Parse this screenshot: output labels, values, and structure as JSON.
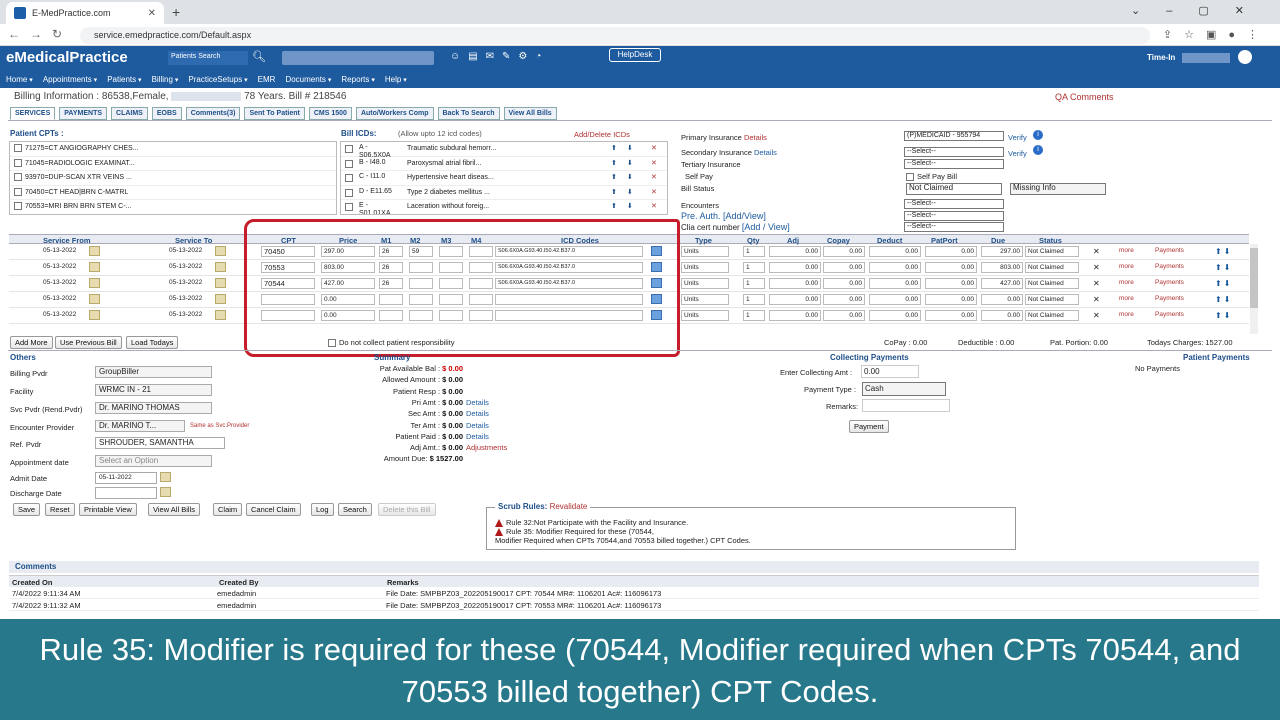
{
  "browser": {
    "tab_title": "E-MedPractice.com",
    "url": "service.emedpractice.com/Default.aspx"
  },
  "header": {
    "logo": "eMedicalPractice",
    "patient_search_placeholder": "Patients Search",
    "helpdesk": "HelpDesk",
    "time_in": "Time-In"
  },
  "menu": [
    "Home",
    "Appointments",
    "Patients",
    "Billing",
    "PracticeSetups",
    "EMR",
    "Documents",
    "Reports",
    "Help"
  ],
  "billing_info": {
    "prefix": "Billing Information :",
    "patient": "86538,Female,",
    "age": "78 Years.",
    "bill_no": "Bill # 218546",
    "qa": "QA Comments"
  },
  "bill_tabs": [
    "SERVICES",
    "PAYMENTS",
    "CLAIMS",
    "EOBS",
    "Comments(3)",
    "Sent To Patient",
    "CMS 1500",
    "Auto/Workers Comp",
    "Back To Search",
    "View All Bills"
  ],
  "patient_cpts": {
    "label": "Patient CPTs :",
    "items": [
      "71275=CT ANGIOGRAPHY CHES...",
      "71045=RADIOLOGIC EXAMINAT...",
      "93970=DUP-SCAN XTR VEINS ...",
      "70450=CT HEAD|BRN C-MATRL",
      "70553=MRI BRN BRN STEM C-..."
    ]
  },
  "bill_icds": {
    "label": "Bill ICDs:",
    "hint": "(Allow upto 12 icd codes)",
    "add_delete": "Add/Delete ICDs",
    "items": [
      {
        "code": "A - S06.5X0A",
        "desc": "Traumatic subdural hemorr..."
      },
      {
        "code": "B - I48.0",
        "desc": "Paroxysmal atrial fibril..."
      },
      {
        "code": "C - I11.0",
        "desc": "Hypertensive heart diseas..."
      },
      {
        "code": "D - E11.65",
        "desc": "Type 2 diabetes mellitus ..."
      },
      {
        "code": "E - S01.01XA",
        "desc": "Laceration without foreig..."
      }
    ]
  },
  "insurance": {
    "primary": "Primary Insurance",
    "secondary": "Secondary Insurance",
    "tertiary": "Tertiary Insurance",
    "self_pay": "Self Pay",
    "details": "Details",
    "verify": "Verify",
    "primary_value": "(P)MEDICAID - 955794",
    "select": "--Select--",
    "self_pay_bill": "Self Pay Bill",
    "bill_status": "Bill Status",
    "bill_status_value": "Not Claimed",
    "missing_info": "Missing Info",
    "encounters": "Encounters",
    "pre_auth": "Pre. Auth.",
    "clia": "Clia cert number",
    "add_view": "[Add/View]",
    "add_view2": "[Add / View]"
  },
  "services_header": [
    "Service From",
    "Service To",
    "CPT",
    "Price",
    "M1",
    "M2",
    "M3",
    "M4",
    "ICD Codes",
    "Type",
    "Qty",
    "Adj",
    "Copay",
    "Deduct",
    "PatPort",
    "Due",
    "Status"
  ],
  "services": [
    {
      "from": "05-13-2022",
      "to": "05-13-2022",
      "cpt": "70450",
      "price": "297.00",
      "m1": "26",
      "m2": "59",
      "icd": "S06.6X0A.G93.40.I50.42.B37.0",
      "type": "Units",
      "qty": "1",
      "adj": "0.00",
      "copay": "0.00",
      "deduct": "0.00",
      "patport": "0.00",
      "due": "297.00",
      "status": "Not Claimed"
    },
    {
      "from": "05-13-2022",
      "to": "05-13-2022",
      "cpt": "70553",
      "price": "803.00",
      "m1": "26",
      "m2": "",
      "icd": "S06.6X0A.G93.40.I50.42.B37.0",
      "type": "Units",
      "qty": "1",
      "adj": "0.00",
      "copay": "0.00",
      "deduct": "0.00",
      "patport": "0.00",
      "due": "803.00",
      "status": "Not Claimed"
    },
    {
      "from": "05-13-2022",
      "to": "05-13-2022",
      "cpt": "70544",
      "price": "427.00",
      "m1": "26",
      "m2": "",
      "icd": "S06.6X0A.G93.40.I50.42.B37.0",
      "type": "Units",
      "qty": "1",
      "adj": "0.00",
      "copay": "0.00",
      "deduct": "0.00",
      "patport": "0.00",
      "due": "427.00",
      "status": "Not Claimed"
    },
    {
      "from": "05-13-2022",
      "to": "05-13-2022",
      "cpt": "",
      "price": "0.00",
      "m1": "",
      "m2": "",
      "icd": "",
      "type": "Units",
      "qty": "1",
      "adj": "0.00",
      "copay": "0.00",
      "deduct": "0.00",
      "patport": "0.00",
      "due": "0.00",
      "status": "Not Claimed"
    },
    {
      "from": "05-13-2022",
      "to": "05-13-2022",
      "cpt": "",
      "price": "0.00",
      "m1": "",
      "m2": "",
      "icd": "",
      "type": "Units",
      "qty": "1",
      "adj": "0.00",
      "copay": "0.00",
      "deduct": "0.00",
      "patport": "0.00",
      "due": "0.00",
      "status": "Not Claimed"
    }
  ],
  "row_links": {
    "more": "more",
    "payments": "Payments"
  },
  "footer_row": {
    "add_more": "Add More",
    "use_prev": "Use Previous Bill",
    "load_today": "Load Todays",
    "no_collect": "Do not collect patient responsibility",
    "copay_l": "CoPay :",
    "copay_v": "0.00",
    "deductible_l": "Deductible :",
    "deductible_v": "0.00",
    "patportion_l": "Pat. Portion:",
    "patportion_v": "0.00",
    "todays_l": "Todays Charges:",
    "todays_v": "1527.00"
  },
  "others": {
    "title": "Others",
    "billing_pvdr": "Billing Pvdr",
    "billing_pvdr_v": "GroupBiller",
    "facility": "Facility",
    "facility_v": "WRMC IN - 21",
    "svc_pvdr": "Svc Pvdr (Rend.Pvdr)",
    "svc_pvdr_v": "Dr. MARINO THOMAS",
    "enc_pvdr": "Encounter Provider",
    "enc_pvdr_v": "Dr. MARINO T...",
    "same_as": "Same as Svc.Provider",
    "ref_pvdr": "Ref. Pvdr",
    "ref_pvdr_v": "SHROUDER, SAMANTHA",
    "appt": "Appointment date",
    "appt_v": "Select an Option",
    "admit": "Admit Date",
    "admit_v": "05-11-2022",
    "discharge": "Discharge Date"
  },
  "summary": {
    "title": "Summary",
    "rows": [
      {
        "label": "Pat Available Bal :",
        "value": "$ 0.00",
        "link": ""
      },
      {
        "label": "Allowed Amount :",
        "value": "$ 0.00",
        "link": ""
      },
      {
        "label": "Patient Resp :",
        "value": "$ 0.00",
        "link": ""
      },
      {
        "label": "Pri Amt :",
        "value": "$ 0.00",
        "link": "Details"
      },
      {
        "label": "Sec Amt :",
        "value": "$ 0.00",
        "link": "Details"
      },
      {
        "label": "Ter Amt :",
        "value": "$ 0.00",
        "link": "Details"
      },
      {
        "label": "Patient Paid :",
        "value": "$ 0.00",
        "link": "Details"
      },
      {
        "label": "Adj Amt.:",
        "value": "$ 0.00",
        "link": "Adjustments"
      },
      {
        "label": "Amount Due:",
        "value": "$ 1527.00",
        "link": ""
      }
    ]
  },
  "collecting": {
    "title": "Collecting Payments",
    "enter_amt": "Enter Collecting Amt :",
    "enter_amt_v": "0.00",
    "ptype": "Payment Type :",
    "ptype_v": "Cash",
    "remarks": "Remarks:",
    "payment_btn": "Payment"
  },
  "patient_payments": {
    "title": "Patient Payments",
    "none": "No Payments"
  },
  "actions": [
    "Save",
    "Reset",
    "Printable View",
    "View All Bills",
    "Claim",
    "Cancel Claim",
    "Log",
    "Search",
    "Delete this Bill"
  ],
  "scrub": {
    "title": "Scrub Rules:",
    "revalidate": "Revalidate",
    "rule1": "Rule 32:Not Participate with the Facility and Insurance.",
    "rule2a": "Rule 35: Modifier Required for these (70544,",
    "rule2b": "Modifier Required when CPTs 70544,and 70553 billed together.) CPT Codes."
  },
  "comments": {
    "title": "Comments",
    "headers": [
      "Created On",
      "Created By",
      "Remarks"
    ],
    "rows": [
      {
        "on": "7/4/2022 9:11:34 AM",
        "by": "emedadmin",
        "remarks": "File Date: SMPBPZ03_202205190017 CPT: 70544 MR#: 1106201 Ac#: 116096173"
      },
      {
        "on": "7/4/2022 9:11:32 AM",
        "by": "emedadmin",
        "remarks": "File Date: SMPBPZ03_202205190017 CPT: 70553 MR#: 1106201 Ac#: 116096173"
      }
    ]
  },
  "caption": "Rule 35: Modifier is required for these (70544, Modifier required when CPTs 70544, and 70553 billed together) CPT Codes."
}
